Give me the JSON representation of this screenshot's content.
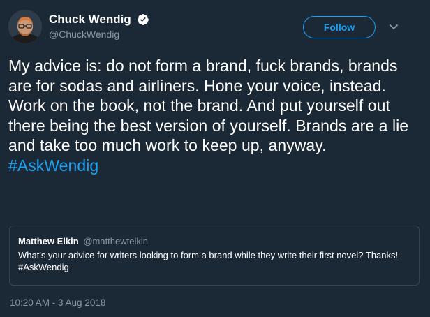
{
  "author": {
    "display_name": "Chuck Wendig",
    "handle": "@ChuckWendig",
    "verified": true,
    "avatar": "avatar-photo"
  },
  "actions": {
    "follow_label": "Follow",
    "menu_icon": "chevron-down-icon"
  },
  "tweet": {
    "text": "My advice is: do not form a brand, fuck brands, brands are for sodas and airliners. Hone your voice, instead. Work on the book, not the brand. And put yourself out there being the best version of yourself. Brands are a lie and take too much work to keep up, anyway. ",
    "hashtag": "#AskWendig",
    "timestamp": "10:20 AM - 3 Aug 2018"
  },
  "quoted_tweet": {
    "display_name": "Matthew Elkin",
    "handle": "@matthewtelkin",
    "text": "What's your advice for writers looking to form a brand while they write their first novel? Thanks! #AskWendig"
  },
  "colors": {
    "background": "#1b2836",
    "accent": "#1da1f2",
    "secondary_text": "#8899a6",
    "border": "#38444d"
  }
}
